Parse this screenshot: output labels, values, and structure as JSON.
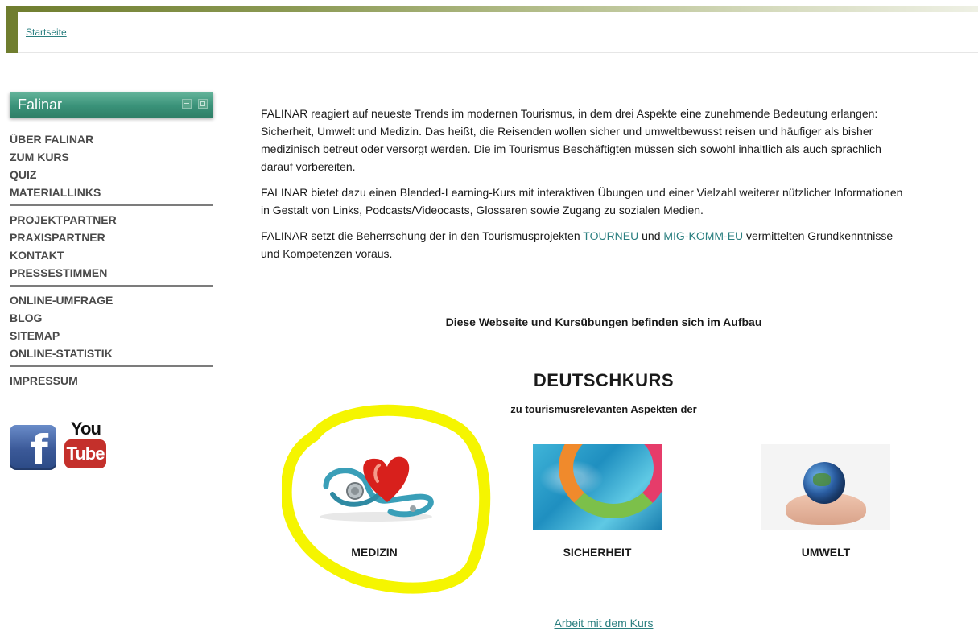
{
  "breadcrumb": "Startseite",
  "sidebar": {
    "title": "Falinar",
    "groups": [
      [
        "ÜBER FALINAR",
        "ZUM KURS",
        "QUIZ",
        "MATERIALLINKS"
      ],
      [
        "PROJEKTPARTNER",
        "PRAXISPARTNER",
        "KONTAKT",
        "PRESSESTIMMEN"
      ],
      [
        "ONLINE-UMFRAGE",
        "BLOG",
        "SITEMAP",
        "ONLINE-STATISTIK"
      ],
      [
        "IMPRESSUM"
      ]
    ],
    "social": {
      "facebook": "f",
      "youtube_you": "You",
      "youtube_tube": "Tube"
    }
  },
  "main": {
    "p1": "FALINAR reagiert auf neueste Trends im modernen Tourismus, in dem drei Aspekte eine zunehmende Bedeutung erlangen: Sicherheit, Umwelt und Medizin. Das heißt, die Reisenden wollen sicher und umweltbewusst reisen und häufiger als bisher medizinisch betreut oder versorgt werden. Die im Tourismus Beschäftigten müssen sich sowohl inhaltlich als auch sprachlich darauf vorbereiten.",
    "p2": "FALINAR bietet dazu einen Blended-Learning-Kurs mit interaktiven Übungen und einer Vielzahl weiterer nützlicher Informationen in Gestalt von Links, Podcasts/Videocasts, Glossaren sowie Zugang zu sozialen Medien.",
    "p3_before": "FALINAR setzt die Beherrschung der in den Tourismusprojekten ",
    "p3_link1": "TOURNEU",
    "p3_mid": " und ",
    "p3_link2": "MIG-KOMM-EU",
    "p3_after": " vermittelten Grundkenntnisse und Kompetenzen voraus.",
    "notice": "Diese Webseite und Kursübungen befinden sich im Aufbau",
    "course_title": "DEUTSCHKURS",
    "course_subtitle": "zu tourismusrelevanten Aspekten der",
    "courses": [
      "MEDIZIN",
      "SICHERHEIT",
      "UMWELT"
    ],
    "footer_link": "Arbeit mit dem Kurs"
  },
  "colors": {
    "link": "#2b7f80",
    "sidebar_header": "#3a9279",
    "highlight": "#f5f500"
  },
  "icons": [
    "facebook-icon",
    "youtube-icon",
    "minimize-icon",
    "restore-icon"
  ]
}
